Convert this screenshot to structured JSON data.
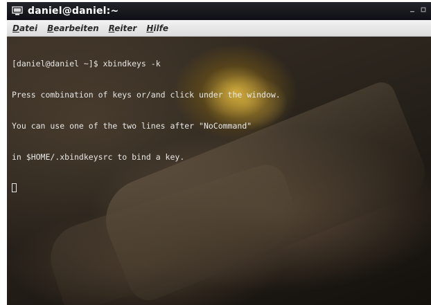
{
  "window": {
    "title": "daniel@daniel:~",
    "icon": "terminal-icon",
    "controls": {
      "minimize": "minimize-icon",
      "maximize": "maximize-icon"
    }
  },
  "menu": {
    "items": [
      {
        "mnemonic": "D",
        "rest": "atei"
      },
      {
        "mnemonic": "B",
        "rest": "earbeiten"
      },
      {
        "mnemonic": "R",
        "rest": "eiter"
      },
      {
        "mnemonic": "H",
        "rest": "ilfe"
      }
    ]
  },
  "terminal": {
    "lines": [
      "[daniel@daniel ~]$ xbindkeys -k",
      "Press combination of keys or/and click under the window.",
      "You can use one of the two lines after \"NoCommand\"",
      "in $HOME/.xbindkeysrc to bind a key."
    ],
    "text_color": "#e8e8e8"
  },
  "colors": {
    "titlebar": "#14141a",
    "menubar": "#e6e6e6",
    "terminal_bg": "#2a241d"
  }
}
